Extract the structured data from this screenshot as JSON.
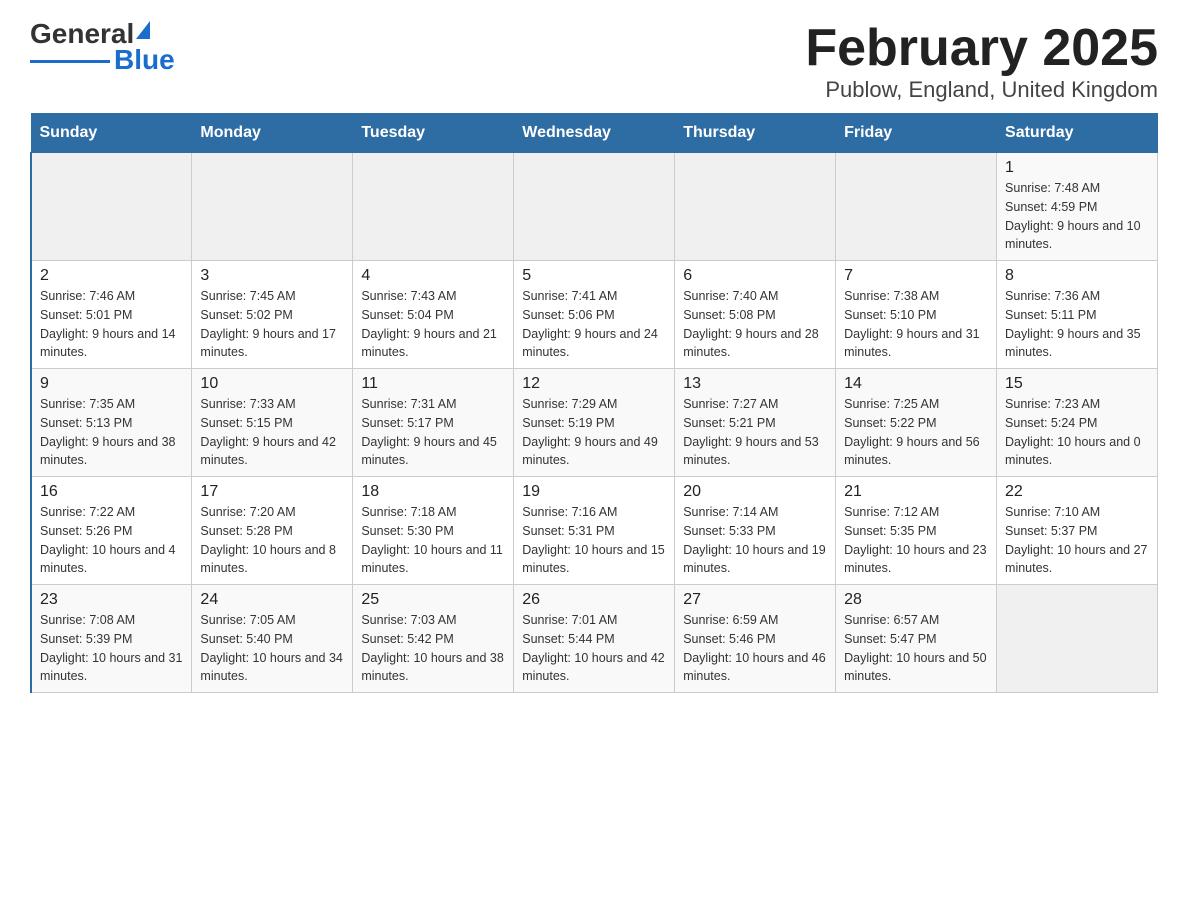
{
  "header": {
    "logo_text_black": "General",
    "logo_text_blue": "Blue",
    "title": "February 2025",
    "subtitle": "Publow, England, United Kingdom"
  },
  "days_of_week": [
    "Sunday",
    "Monday",
    "Tuesday",
    "Wednesday",
    "Thursday",
    "Friday",
    "Saturday"
  ],
  "weeks": [
    {
      "days": [
        {
          "num": "",
          "info": ""
        },
        {
          "num": "",
          "info": ""
        },
        {
          "num": "",
          "info": ""
        },
        {
          "num": "",
          "info": ""
        },
        {
          "num": "",
          "info": ""
        },
        {
          "num": "",
          "info": ""
        },
        {
          "num": "1",
          "info": "Sunrise: 7:48 AM\nSunset: 4:59 PM\nDaylight: 9 hours and 10 minutes."
        }
      ]
    },
    {
      "days": [
        {
          "num": "2",
          "info": "Sunrise: 7:46 AM\nSunset: 5:01 PM\nDaylight: 9 hours and 14 minutes."
        },
        {
          "num": "3",
          "info": "Sunrise: 7:45 AM\nSunset: 5:02 PM\nDaylight: 9 hours and 17 minutes."
        },
        {
          "num": "4",
          "info": "Sunrise: 7:43 AM\nSunset: 5:04 PM\nDaylight: 9 hours and 21 minutes."
        },
        {
          "num": "5",
          "info": "Sunrise: 7:41 AM\nSunset: 5:06 PM\nDaylight: 9 hours and 24 minutes."
        },
        {
          "num": "6",
          "info": "Sunrise: 7:40 AM\nSunset: 5:08 PM\nDaylight: 9 hours and 28 minutes."
        },
        {
          "num": "7",
          "info": "Sunrise: 7:38 AM\nSunset: 5:10 PM\nDaylight: 9 hours and 31 minutes."
        },
        {
          "num": "8",
          "info": "Sunrise: 7:36 AM\nSunset: 5:11 PM\nDaylight: 9 hours and 35 minutes."
        }
      ]
    },
    {
      "days": [
        {
          "num": "9",
          "info": "Sunrise: 7:35 AM\nSunset: 5:13 PM\nDaylight: 9 hours and 38 minutes."
        },
        {
          "num": "10",
          "info": "Sunrise: 7:33 AM\nSunset: 5:15 PM\nDaylight: 9 hours and 42 minutes."
        },
        {
          "num": "11",
          "info": "Sunrise: 7:31 AM\nSunset: 5:17 PM\nDaylight: 9 hours and 45 minutes."
        },
        {
          "num": "12",
          "info": "Sunrise: 7:29 AM\nSunset: 5:19 PM\nDaylight: 9 hours and 49 minutes."
        },
        {
          "num": "13",
          "info": "Sunrise: 7:27 AM\nSunset: 5:21 PM\nDaylight: 9 hours and 53 minutes."
        },
        {
          "num": "14",
          "info": "Sunrise: 7:25 AM\nSunset: 5:22 PM\nDaylight: 9 hours and 56 minutes."
        },
        {
          "num": "15",
          "info": "Sunrise: 7:23 AM\nSunset: 5:24 PM\nDaylight: 10 hours and 0 minutes."
        }
      ]
    },
    {
      "days": [
        {
          "num": "16",
          "info": "Sunrise: 7:22 AM\nSunset: 5:26 PM\nDaylight: 10 hours and 4 minutes."
        },
        {
          "num": "17",
          "info": "Sunrise: 7:20 AM\nSunset: 5:28 PM\nDaylight: 10 hours and 8 minutes."
        },
        {
          "num": "18",
          "info": "Sunrise: 7:18 AM\nSunset: 5:30 PM\nDaylight: 10 hours and 11 minutes."
        },
        {
          "num": "19",
          "info": "Sunrise: 7:16 AM\nSunset: 5:31 PM\nDaylight: 10 hours and 15 minutes."
        },
        {
          "num": "20",
          "info": "Sunrise: 7:14 AM\nSunset: 5:33 PM\nDaylight: 10 hours and 19 minutes."
        },
        {
          "num": "21",
          "info": "Sunrise: 7:12 AM\nSunset: 5:35 PM\nDaylight: 10 hours and 23 minutes."
        },
        {
          "num": "22",
          "info": "Sunrise: 7:10 AM\nSunset: 5:37 PM\nDaylight: 10 hours and 27 minutes."
        }
      ]
    },
    {
      "days": [
        {
          "num": "23",
          "info": "Sunrise: 7:08 AM\nSunset: 5:39 PM\nDaylight: 10 hours and 31 minutes."
        },
        {
          "num": "24",
          "info": "Sunrise: 7:05 AM\nSunset: 5:40 PM\nDaylight: 10 hours and 34 minutes."
        },
        {
          "num": "25",
          "info": "Sunrise: 7:03 AM\nSunset: 5:42 PM\nDaylight: 10 hours and 38 minutes."
        },
        {
          "num": "26",
          "info": "Sunrise: 7:01 AM\nSunset: 5:44 PM\nDaylight: 10 hours and 42 minutes."
        },
        {
          "num": "27",
          "info": "Sunrise: 6:59 AM\nSunset: 5:46 PM\nDaylight: 10 hours and 46 minutes."
        },
        {
          "num": "28",
          "info": "Sunrise: 6:57 AM\nSunset: 5:47 PM\nDaylight: 10 hours and 50 minutes."
        },
        {
          "num": "",
          "info": ""
        }
      ]
    }
  ]
}
